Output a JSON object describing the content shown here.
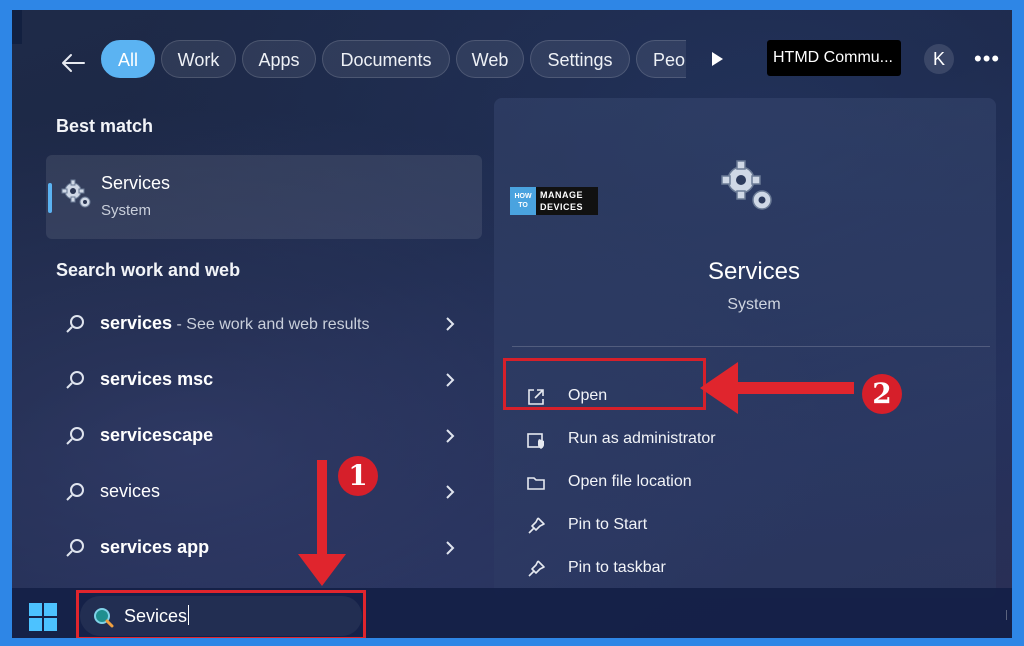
{
  "filters": {
    "chips": [
      {
        "label": "All",
        "active": true
      },
      {
        "label": "Work",
        "active": false
      },
      {
        "label": "Apps",
        "active": false
      },
      {
        "label": "Documents",
        "active": false
      },
      {
        "label": "Web",
        "active": false
      },
      {
        "label": "Settings",
        "active": false
      },
      {
        "label": "Peo",
        "active": false
      }
    ],
    "account_label": "HTMD Commu...",
    "avatar_initial": "K",
    "more_label": "•••"
  },
  "best_match": {
    "heading": "Best match",
    "title": "Services",
    "subtitle": "System"
  },
  "search_web": {
    "heading": "Search work and web",
    "results": [
      {
        "query": "services",
        "hint": " - See work and web results"
      },
      {
        "query": "services msc",
        "hint": ""
      },
      {
        "query": "servicescape",
        "hint": ""
      },
      {
        "query": "sevices",
        "hint": ""
      },
      {
        "query": "services app",
        "hint": ""
      }
    ]
  },
  "detail": {
    "logo_top": "HOW TO",
    "logo_main": "MANAGE DEVICES",
    "title": "Services",
    "subtitle": "System",
    "actions": [
      {
        "label": "Open",
        "icon": "open-external-icon"
      },
      {
        "label": "Run as administrator",
        "icon": "shield-icon"
      },
      {
        "label": "Open file location",
        "icon": "folder-icon"
      },
      {
        "label": "Pin to Start",
        "icon": "pin-icon"
      },
      {
        "label": "Pin to taskbar",
        "icon": "pin-icon"
      }
    ]
  },
  "taskbar": {
    "search_value": "Sevices"
  },
  "annotations": {
    "badge_1": "1",
    "badge_2": "2"
  },
  "colors": {
    "accent": "#5bb3f2",
    "annotation_red": "#e0252d",
    "frame_blue": "#2e86e6"
  }
}
